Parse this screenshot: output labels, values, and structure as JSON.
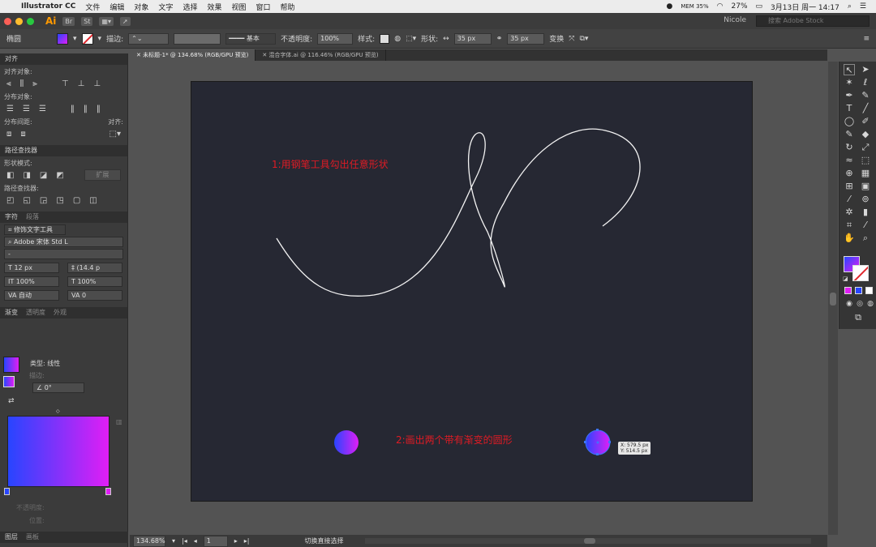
{
  "menubar": {
    "app_name": "Illustrator CC",
    "menus": [
      "文件",
      "编辑",
      "对象",
      "文字",
      "选择",
      "效果",
      "视图",
      "窗口",
      "帮助"
    ],
    "battery": "27%",
    "datetime": "3月13日 周一  14:17",
    "mem": "MEM 35%"
  },
  "appbar": {
    "logo": "Ai",
    "buttons": [
      "Br",
      "St"
    ],
    "user": "Nicole",
    "stock_placeholder": "搜索 Adobe Stock"
  },
  "control": {
    "object_type": "椭圆",
    "stroke_label": "描边:",
    "stroke_profile": "基本",
    "opacity_label": "不透明度:",
    "opacity_value": "100%",
    "style_label": "样式:",
    "shape_label": "形状:",
    "width_value": "35 px",
    "height_value": "35 px",
    "transform_label": "变换",
    "fill_color": "#7a3cf0"
  },
  "align_panel": {
    "title": "对齐",
    "align_objects": "对齐对象:",
    "distribute_objects": "分布对象:",
    "distribute_spacing": "分布间距:",
    "align_to": "对齐:"
  },
  "pathfinder_panel": {
    "title": "路径查找器",
    "shape_modes": "形状模式:",
    "expand": "扩展",
    "pathfinders": "路径查找器:"
  },
  "character_panel": {
    "tabs": [
      "字符",
      "段落"
    ],
    "touch_type": "修饰文字工具",
    "font_family": "Adobe 宋体 Std L",
    "font_style": "-",
    "font_size": "12 px",
    "leading": "(14.4 p",
    "vscale": "100%",
    "hscale": "100%",
    "kerning": "自动",
    "tracking": "0"
  },
  "gradient_panel": {
    "tabs": [
      "渐变",
      "透明度",
      "外观"
    ],
    "type_label": "类型:",
    "type_value": "线性",
    "stroke_label": "描边:",
    "angle": "0°",
    "opacity_label": "不透明度:",
    "location_label": "位置:",
    "start_color": "#2845ff",
    "end_color": "#e01ef5"
  },
  "layers_tabs": [
    "图层",
    "画板"
  ],
  "doc_tabs": [
    "未标题-1* @ 134.68% (RGB/GPU 预览)",
    "混合字体.ai @ 116.46% (RGB/GPU 预览)"
  ],
  "canvas": {
    "step1": "1:用钢笔工具勾出任意形状",
    "step2": "2:画出两个带有渐变的圆形",
    "readout_x": "X: 579.5 px",
    "readout_y": "Y: 514.5 px",
    "artboard_color": "#262833"
  },
  "status": {
    "zoom": "134.68%",
    "artboard": "1",
    "tool_hint": "切换直接选择"
  }
}
